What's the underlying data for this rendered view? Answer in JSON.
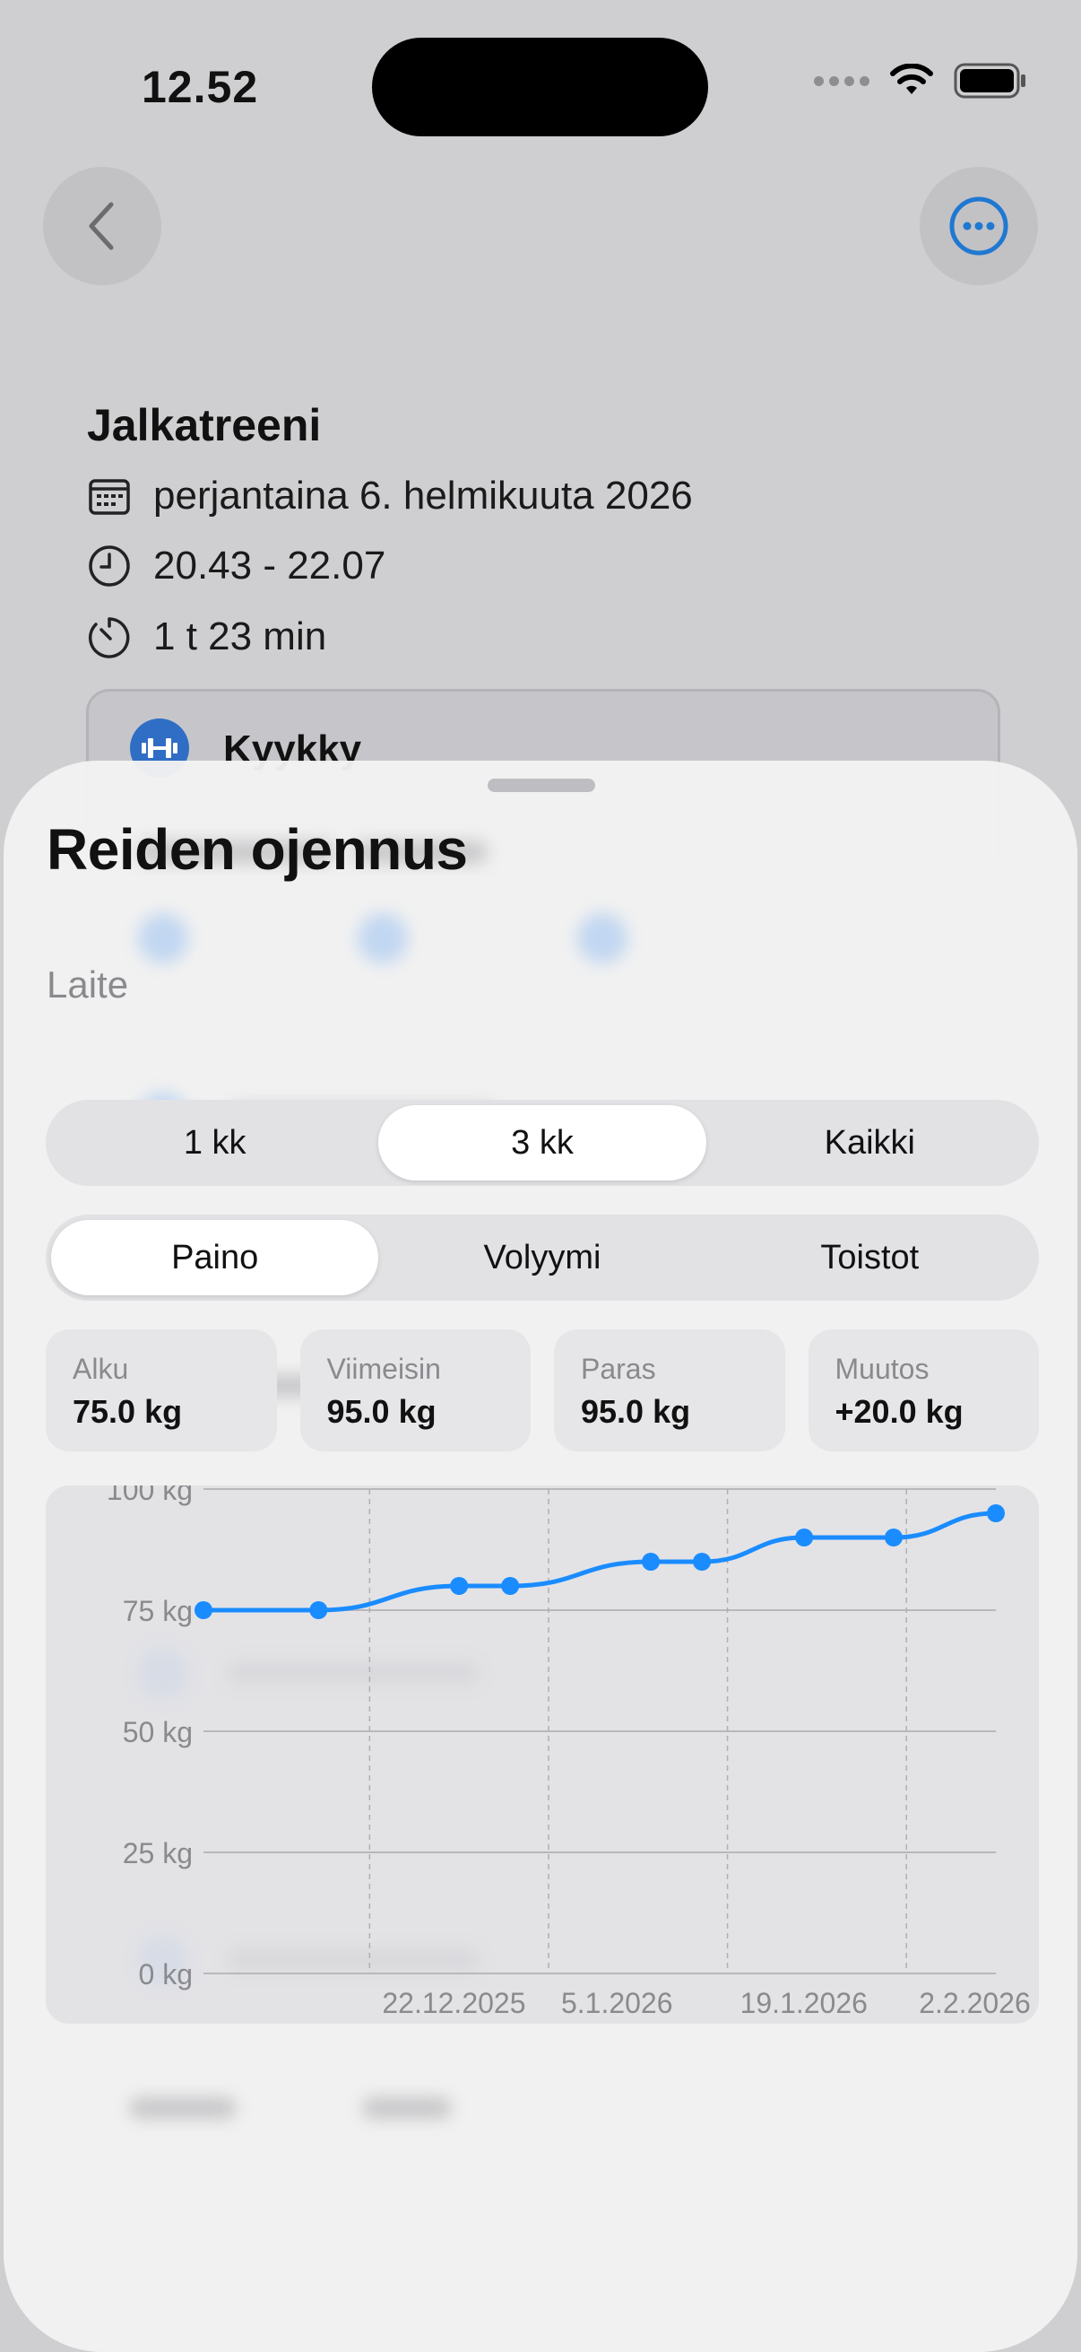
{
  "status_bar": {
    "time": "12.52"
  },
  "workout": {
    "title": "Jalkatreeni",
    "date": "perjantaina 6. helmikuuta 2026",
    "time_range": "20.43 - 22.07",
    "duration": "1 t 23 min",
    "exercise_name": "Kyykky"
  },
  "sheet": {
    "title": "Reiden ojennus",
    "subtitle": "Laite",
    "range_tabs": [
      {
        "label": "1 kk",
        "active": false
      },
      {
        "label": "3 kk",
        "active": true
      },
      {
        "label": "Kaikki",
        "active": false
      }
    ],
    "metric_tabs": [
      {
        "label": "Paino",
        "active": true
      },
      {
        "label": "Volyymi",
        "active": false
      },
      {
        "label": "Toistot",
        "active": false
      }
    ],
    "stats": [
      {
        "label": "Alku",
        "value": "75.0 kg"
      },
      {
        "label": "Viimeisin",
        "value": "95.0 kg"
      },
      {
        "label": "Paras",
        "value": "95.0 kg"
      },
      {
        "label": "Muutos",
        "value": "+20.0 kg"
      }
    ]
  },
  "colors": {
    "accent": "#1a8cff",
    "background_dim": "#cfcfd1",
    "sheet": "#f2f2f3"
  },
  "icons": [
    "chevron-left-icon",
    "more-icon",
    "calendar-icon",
    "clock-icon",
    "timer-icon",
    "dumbbell-icon",
    "wifi-icon",
    "battery-icon"
  ],
  "chart_data": {
    "type": "line",
    "ylim": [
      0,
      100
    ],
    "y_ticks": [
      "0 kg",
      "25 kg",
      "50 kg",
      "75 kg",
      "100 kg"
    ],
    "y_tick_values": [
      0,
      25,
      50,
      75,
      100
    ],
    "x_range": [
      "2025-12-09",
      "2026-02-09"
    ],
    "x_ticks": [
      {
        "label": "22.12.2025",
        "date": "2025-12-22"
      },
      {
        "label": "5.1.2026",
        "date": "2026-01-05"
      },
      {
        "label": "19.1.2026",
        "date": "2026-01-19"
      },
      {
        "label": "2.2.2026",
        "date": "2026-02-02"
      }
    ],
    "series": [
      {
        "points": [
          {
            "x": "2025-12-09",
            "y": 75
          },
          {
            "x": "2025-12-18",
            "y": 75
          },
          {
            "x": "2025-12-29",
            "y": 80
          },
          {
            "x": "2026-01-02",
            "y": 80
          },
          {
            "x": "2026-01-13",
            "y": 85
          },
          {
            "x": "2026-01-17",
            "y": 85
          },
          {
            "x": "2026-01-25",
            "y": 90
          },
          {
            "x": "2026-02-01",
            "y": 90
          },
          {
            "x": "2026-02-09",
            "y": 95
          }
        ]
      }
    ]
  }
}
